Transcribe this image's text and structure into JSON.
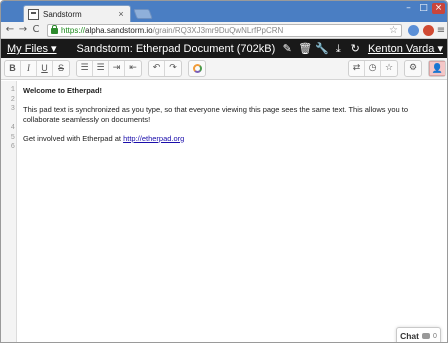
{
  "browser": {
    "tab_title": "Sandstorm",
    "tab_close": "×",
    "url_scheme": "https://",
    "url_host": "alpha.sandstorm.io",
    "url_path": "/grain/RQ3XJ3mr9DuQwNLrfPpCRN",
    "nav": {
      "back": "←",
      "forward": "→",
      "reload": "C"
    },
    "star": "☆",
    "menu": "≡",
    "win": {
      "minimize": "–",
      "maximize": "□",
      "close": "×"
    }
  },
  "sandstorm": {
    "my_files": "My Files ▾",
    "title": "Sandstorm: Etherpad Document (702kB)",
    "icons": {
      "edit": "✎",
      "delete": "🗑",
      "settings": "🔧",
      "download": "⤓",
      "restart": "↻"
    },
    "user": "Kenton Varda ▾"
  },
  "etherpad": {
    "format": {
      "bold": "B",
      "italic": "I",
      "underline": "U",
      "strike": "S"
    },
    "list": {
      "ordered": "☰",
      "unordered": "☰",
      "indent": "⇥",
      "outdent": "⇤"
    },
    "history": {
      "undo": "↶",
      "redo": "↷"
    },
    "right": {
      "import_export": "⇄",
      "timeslider": "◷",
      "star": "☆",
      "settings": "⚙",
      "user": "👤"
    }
  },
  "pad": {
    "line_numbers": [
      "1",
      "2",
      "3",
      "4",
      "5",
      "6"
    ],
    "title": "Welcome to Etherpad!",
    "para": "This pad text is synchronized as you type, so that everyone viewing this page sees the same text. This allows you to collaborate seamlessly on documents!",
    "get_involved": "Get involved with Etherpad at ",
    "link": "http://etherpad.org"
  },
  "chat": {
    "label": "Chat",
    "count": "0"
  },
  "colors": {
    "sandstorm_bar": "#191919",
    "tab_strip": "#4a7ec3"
  }
}
